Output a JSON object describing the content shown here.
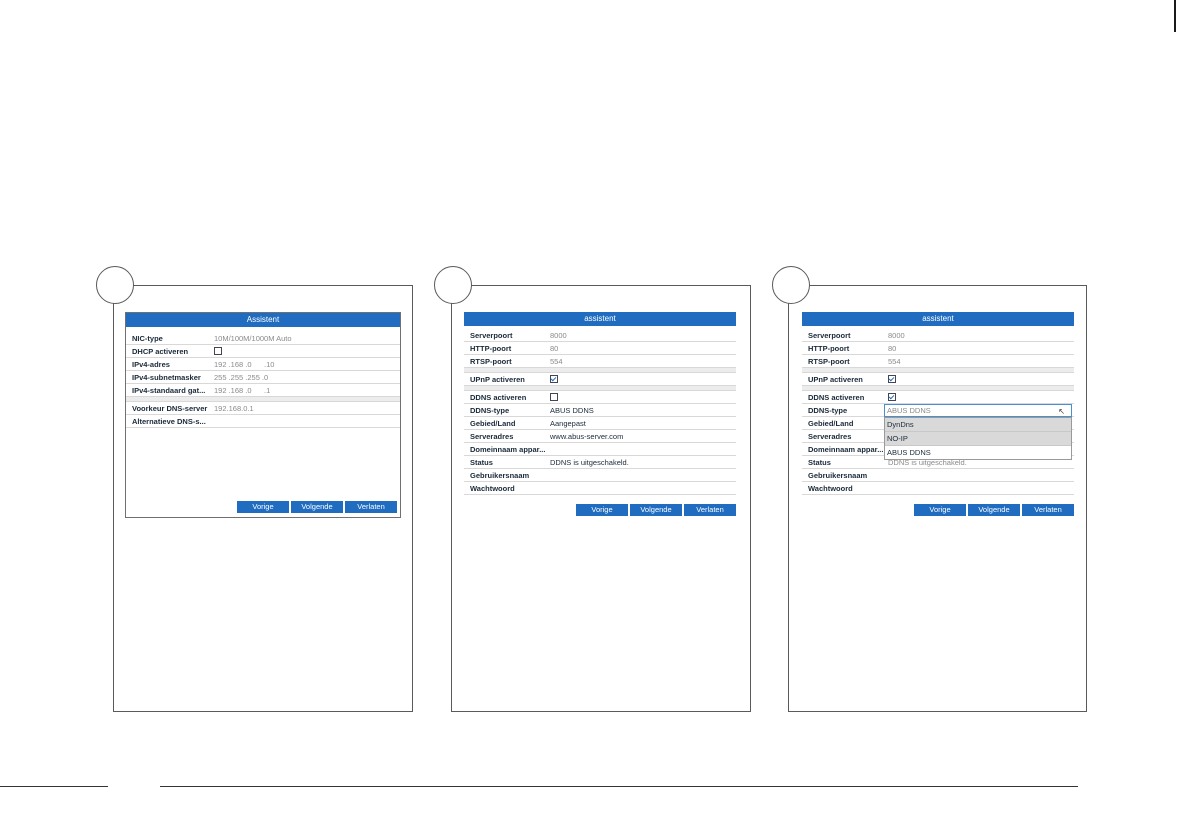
{
  "panel1": {
    "title": "Assistent",
    "rows": [
      {
        "label": "NIC-type",
        "value": "10M/100M/1000M Auto"
      },
      {
        "label": "DHCP activeren",
        "value": ""
      },
      {
        "label": "IPv4-adres",
        "value": "192 .168 .0      .10"
      },
      {
        "label": "IPv4-subnetmasker",
        "value": "255 .255 .255 .0"
      },
      {
        "label": "IPv4-standaard gat...",
        "value": "192 .168 .0      .1"
      },
      {
        "label": "Voorkeur DNS-server",
        "value": "192.168.0.1"
      },
      {
        "label": "Alternatieve DNS-s...",
        "value": ""
      }
    ],
    "buttons": {
      "prev": "Vorige",
      "next": "Volgende",
      "exit": "Verlaten"
    }
  },
  "panel2": {
    "title": "assistent",
    "rows": [
      {
        "label": "Serverpoort",
        "value": "8000"
      },
      {
        "label": "HTTP-poort",
        "value": "80"
      },
      {
        "label": "RTSP-poort",
        "value": "554"
      },
      {
        "label": "UPnP activeren",
        "value": ""
      },
      {
        "label": "DDNS activeren",
        "value": ""
      },
      {
        "label": "DDNS-type",
        "value": "ABUS DDNS"
      },
      {
        "label": "Gebied/Land",
        "value": "Aangepast"
      },
      {
        "label": "Serveradres",
        "value": "www.abus-server.com"
      },
      {
        "label": "Domeinnaam appar...",
        "value": ""
      },
      {
        "label": "Status",
        "value": "DDNS is uitgeschakeld."
      },
      {
        "label": "Gebruikersnaam",
        "value": ""
      },
      {
        "label": "Wachtwoord",
        "value": ""
      }
    ],
    "upnp_checked": true,
    "ddns_checked": false,
    "buttons": {
      "prev": "Vorige",
      "next": "Volgende",
      "exit": "Verlaten"
    }
  },
  "panel3": {
    "title": "assistent",
    "rows": [
      {
        "label": "Serverpoort",
        "value": "8000"
      },
      {
        "label": "HTTP-poort",
        "value": "80"
      },
      {
        "label": "RTSP-poort",
        "value": "554"
      },
      {
        "label": "UPnP activeren",
        "value": ""
      },
      {
        "label": "DDNS activeren",
        "value": ""
      },
      {
        "label": "DDNS-type",
        "value": ""
      },
      {
        "label": "Gebied/Land",
        "value": ""
      },
      {
        "label": "Serveradres",
        "value": ""
      },
      {
        "label": "Domeinnaam appar...",
        "value": ""
      },
      {
        "label": "Status",
        "value": "DDNS is uitgeschakeld."
      },
      {
        "label": "Gebruikersnaam",
        "value": ""
      },
      {
        "label": "Wachtwoord",
        "value": ""
      }
    ],
    "upnp_checked": true,
    "ddns_checked": true,
    "dropdown": {
      "selected": "ABUS DDNS",
      "options": [
        "DynDns",
        "NO-IP",
        "ABUS DDNS"
      ]
    },
    "buttons": {
      "prev": "Vorige",
      "next": "Volgende",
      "exit": "Verlaten"
    }
  },
  "colors": {
    "accent": "#1f6cc0",
    "border": "#5a5a5a"
  },
  "icons": {
    "cursor": "mouse-pointer-icon",
    "checkbox": "checkbox-icon"
  }
}
